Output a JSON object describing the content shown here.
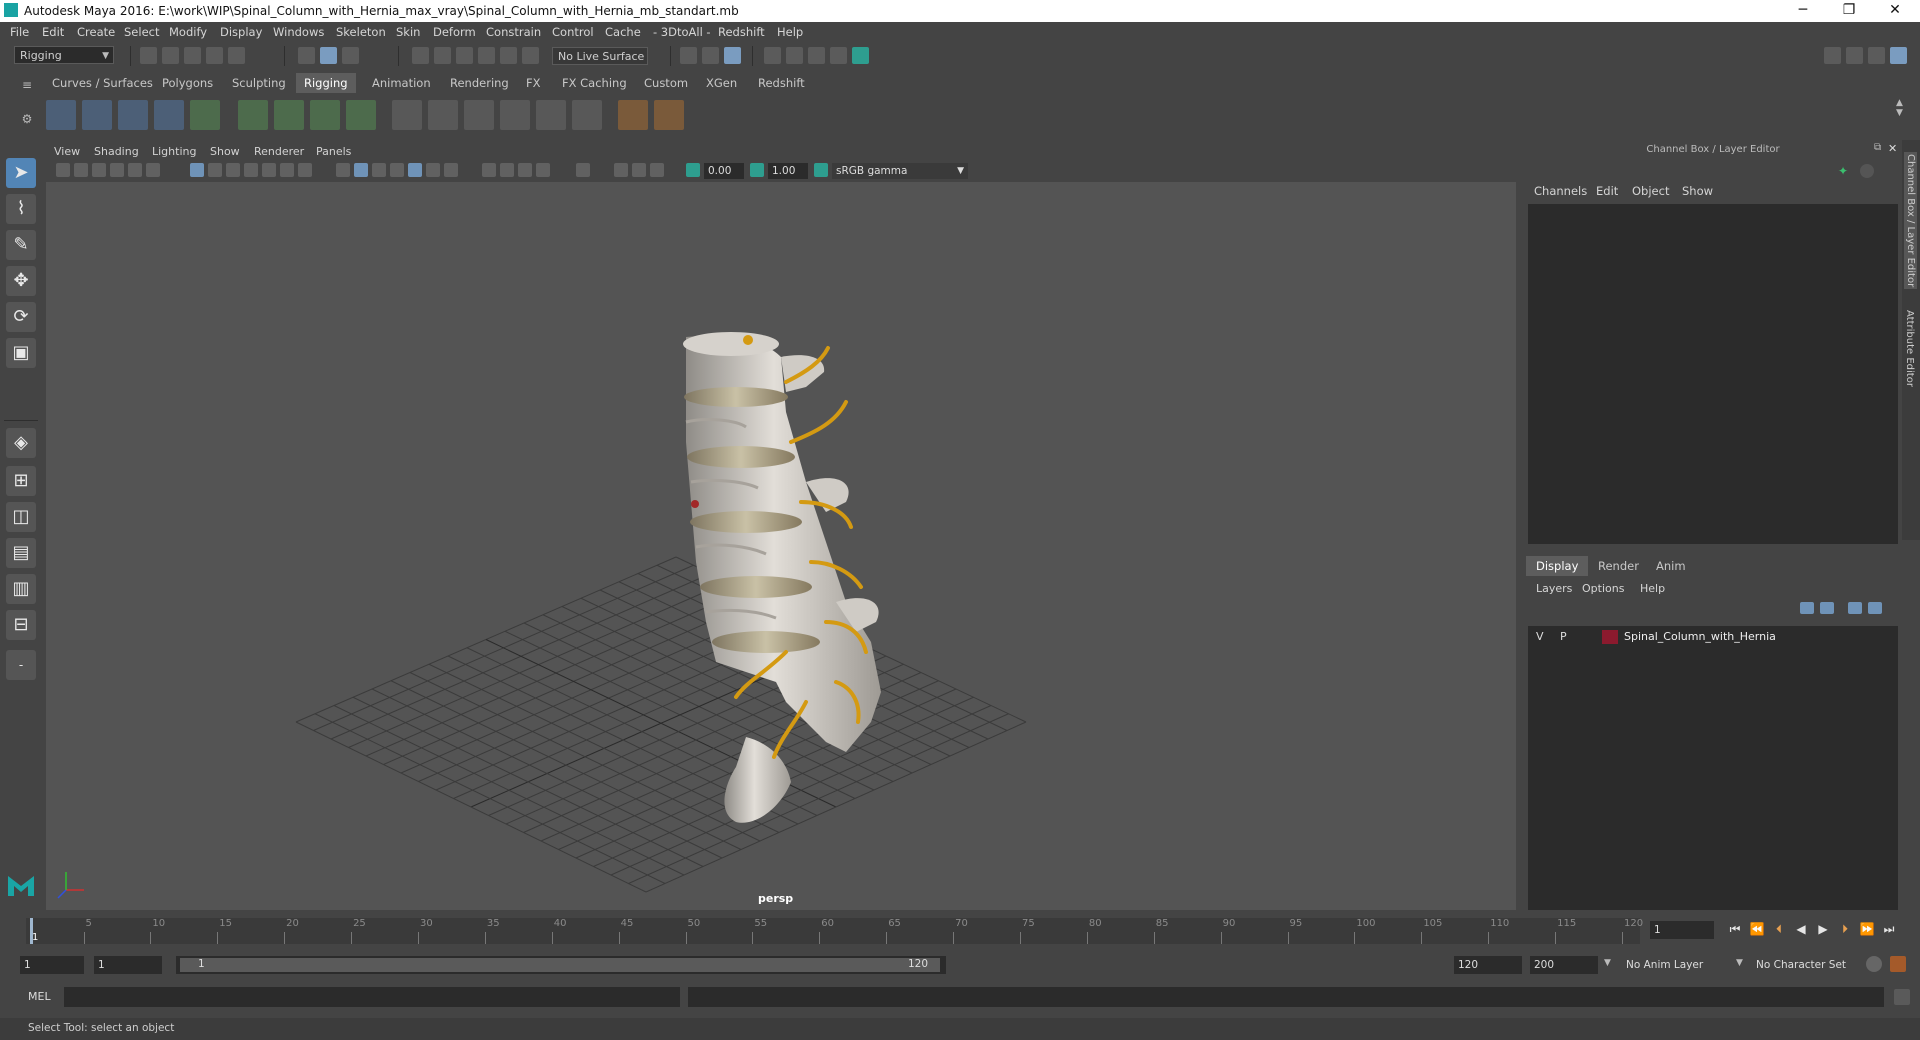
{
  "window": {
    "title": "Autodesk Maya 2016: E:\\work\\WIP\\Spinal_Column_with_Hernia_max_vray\\Spinal_Column_with_Hernia_mb_standart.mb",
    "controls": [
      "─",
      "❐",
      "✕"
    ]
  },
  "menubar": [
    "File",
    "Edit",
    "Create",
    "Select",
    "Modify",
    "Display",
    "Windows",
    "Skeleton",
    "Skin",
    "Deform",
    "Constrain",
    "Control",
    "Cache",
    "- 3DtoAll -",
    "Redshift",
    "Help"
  ],
  "statusline": {
    "mode": "Rigging",
    "live_surface": "No Live Surface"
  },
  "shelf": {
    "tabs": [
      "Curves / Surfaces",
      "Polygons",
      "Sculpting",
      "Rigging",
      "Animation",
      "Rendering",
      "FX",
      "FX Caching",
      "Custom",
      "XGen",
      "Redshift"
    ],
    "active": "Rigging"
  },
  "viewport": {
    "menus": [
      "View",
      "Shading",
      "Lighting",
      "Show",
      "Renderer",
      "Panels"
    ],
    "exposure": "0.00",
    "gamma": "1.00",
    "color_space": "sRGB gamma",
    "camera": "persp"
  },
  "channel_box": {
    "title": "Channel Box / Layer Editor",
    "menus": [
      "Channels",
      "Edit",
      "Object",
      "Show"
    ]
  },
  "layer_editor": {
    "tabs": [
      "Display",
      "Render",
      "Anim"
    ],
    "active_tab": "Display",
    "menus": [
      "Layers",
      "Options",
      "Help"
    ],
    "layers": [
      {
        "visible": "V",
        "playback": "P",
        "color": "#8b1a2e",
        "name": "Spinal_Column_with_Hernia"
      }
    ]
  },
  "side_tabs": [
    "Channel Box / Layer Editor",
    "Attribute Editor"
  ],
  "timeline": {
    "ticks": [
      "1",
      "5",
      "10",
      "15",
      "20",
      "25",
      "30",
      "35",
      "40",
      "45",
      "50",
      "55",
      "60",
      "65",
      "70",
      "75",
      "80",
      "85",
      "90",
      "95",
      "100",
      "105",
      "110",
      "115",
      "120"
    ],
    "current_frame": "1"
  },
  "range": {
    "start": "1",
    "playback_start": "1",
    "slider_start": "1",
    "slider_end": "120",
    "playback_end": "120",
    "end": "200",
    "anim_layer": "No Anim Layer",
    "character_set": "No Character Set"
  },
  "command_line": {
    "label": "MEL"
  },
  "help_line": {
    "text": "Select Tool: select an object"
  }
}
